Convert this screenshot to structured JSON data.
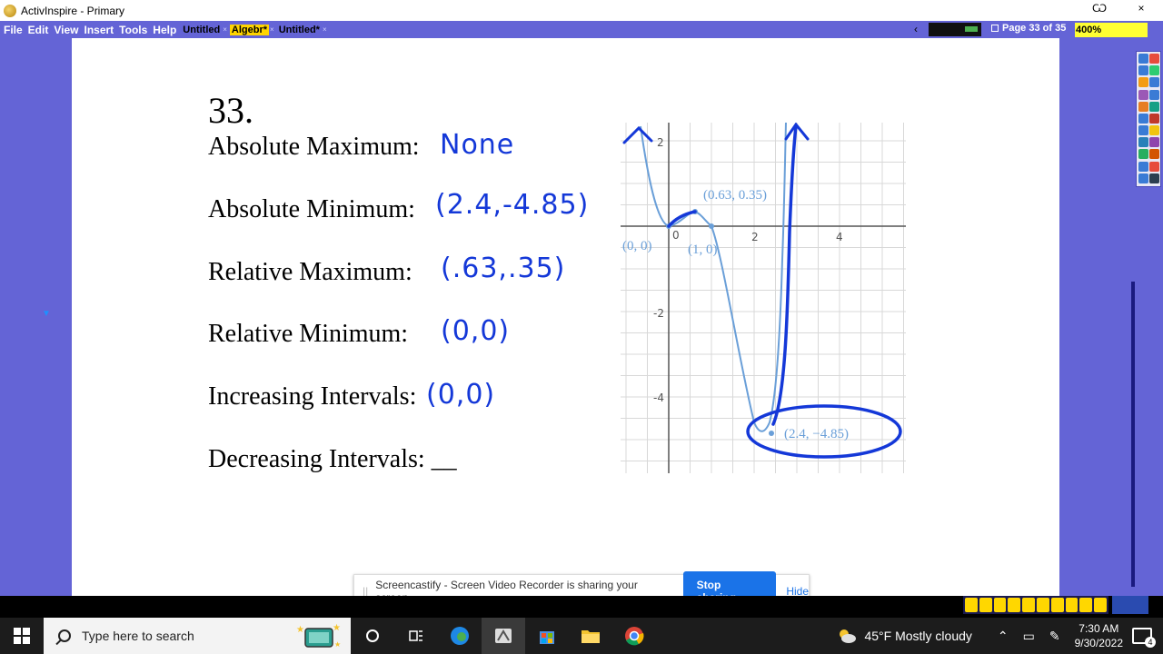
{
  "window": {
    "title": "ActivInspire - Primary",
    "minimize_glyph": "–",
    "restore_glyph": "Ѡ",
    "close_glyph": "×"
  },
  "menu": {
    "items": [
      "File",
      "Edit",
      "View",
      "Insert",
      "Tools",
      "Help"
    ],
    "doc_tabs": [
      {
        "label": "Untitled",
        "active": false
      },
      {
        "label": "Algebr*",
        "active": true
      },
      {
        "label": "Untitled*",
        "active": false
      }
    ],
    "nav_arrow": "‹",
    "page_indicator": "Page 33 of 35",
    "zoom": "400%"
  },
  "page": {
    "question_number": "33.",
    "rows": [
      {
        "label": "Absolute Maximum:",
        "answer": "None"
      },
      {
        "label": "Absolute Minimum:",
        "answer": "(2.4,-4.85)"
      },
      {
        "label": "Relative Maximum:",
        "answer": "(.63,.35)"
      },
      {
        "label": "Relative Minimum:",
        "answer": "(0,0)"
      },
      {
        "label": "Increasing Intervals:",
        "answer": "(0,0)"
      },
      {
        "label": "Decreasing Intervals: __",
        "answer": ""
      }
    ]
  },
  "graph": {
    "x_ticks": [
      "2",
      "4"
    ],
    "y_ticks": [
      "2",
      "-2",
      "-4"
    ],
    "origin_label": "0",
    "point_labels": {
      "origin": "(0, 0)",
      "rel_max": "(0.63, 0.35)",
      "root": "(1, 0)",
      "min": "(2.4, −4.85)"
    },
    "curve_color": "#6a9fd8",
    "ink_color": "#1438d8"
  },
  "share_bar": {
    "message": "Screencastify - Screen Video Recorder is sharing your screen.",
    "stop_label": "Stop sharing",
    "hide_label": "Hide"
  },
  "taskbar": {
    "search_placeholder": "Type here to search",
    "weather": "45°F  Mostly cloudy",
    "time": "7:30 AM",
    "date": "9/30/2022",
    "notification_count": "4"
  }
}
